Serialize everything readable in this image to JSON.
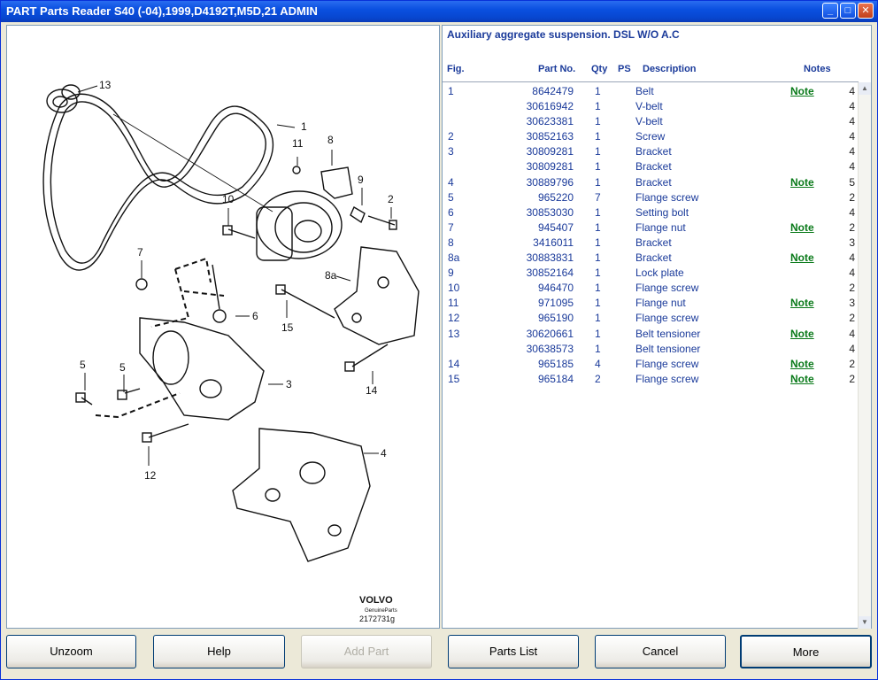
{
  "window": {
    "title": "PART Parts Reader S40 (-04),1999,D4192T,M5D,21 ADMIN",
    "minimize": "_",
    "maximize": "□",
    "close": "✕"
  },
  "drawing": {
    "callouts": [
      "13",
      "1",
      "11",
      "8",
      "9",
      "2",
      "10",
      "7",
      "8a",
      "6",
      "15",
      "5",
      "5",
      "3",
      "14",
      "4",
      "12"
    ],
    "brand": "VOLVO",
    "brand_sub": "GenuineParts",
    "drawing_no": "2172731g"
  },
  "list": {
    "section_title": "Auxiliary aggregate suspension. DSL W/O A.C",
    "headers": {
      "fig": "Fig.",
      "part": "Part No.",
      "qty": "Qty",
      "ps": "PS",
      "desc": "Description",
      "notes": "Notes"
    },
    "rows": [
      {
        "fig": "1",
        "part": "8642479",
        "qty": "1",
        "desc": "Belt",
        "note": "Note",
        "n": "4"
      },
      {
        "fig": "",
        "part": "30616942",
        "qty": "1",
        "desc": "V-belt",
        "note": "",
        "n": "4"
      },
      {
        "fig": "",
        "part": "30623381",
        "qty": "1",
        "desc": "V-belt",
        "note": "",
        "n": "4"
      },
      {
        "fig": "2",
        "part": "30852163",
        "qty": "1",
        "desc": "Screw",
        "note": "",
        "n": "4"
      },
      {
        "fig": "3",
        "part": "30809281",
        "qty": "1",
        "desc": "Bracket",
        "note": "",
        "n": "4"
      },
      {
        "fig": "",
        "part": "30809281",
        "qty": "1",
        "desc": "Bracket",
        "note": "",
        "n": "4"
      },
      {
        "fig": "4",
        "part": "30889796",
        "qty": "1",
        "desc": "Bracket",
        "note": "Note",
        "n": "5"
      },
      {
        "fig": "5",
        "part": "965220",
        "qty": "7",
        "desc": "Flange screw",
        "note": "",
        "n": "2"
      },
      {
        "fig": "6",
        "part": "30853030",
        "qty": "1",
        "desc": "Setting bolt",
        "note": "",
        "n": "4"
      },
      {
        "fig": "7",
        "part": "945407",
        "qty": "1",
        "desc": "Flange nut",
        "note": "Note",
        "n": "2"
      },
      {
        "fig": "8",
        "part": "3416011",
        "qty": "1",
        "desc": "Bracket",
        "note": "",
        "n": "3"
      },
      {
        "fig": "8a",
        "part": "30883831",
        "qty": "1",
        "desc": "Bracket",
        "note": "Note",
        "n": "4"
      },
      {
        "fig": "9",
        "part": "30852164",
        "qty": "1",
        "desc": "Lock plate",
        "note": "",
        "n": "4"
      },
      {
        "fig": "10",
        "part": "946470",
        "qty": "1",
        "desc": "Flange screw",
        "note": "",
        "n": "2"
      },
      {
        "fig": "11",
        "part": "971095",
        "qty": "1",
        "desc": "Flange nut",
        "note": "Note",
        "n": "3"
      },
      {
        "fig": "12",
        "part": "965190",
        "qty": "1",
        "desc": "Flange screw",
        "note": "",
        "n": "2"
      },
      {
        "fig": "13",
        "part": "30620661",
        "qty": "1",
        "desc": "Belt tensioner",
        "note": "Note",
        "n": "4"
      },
      {
        "fig": "",
        "part": "30638573",
        "qty": "1",
        "desc": "Belt tensioner",
        "note": "",
        "n": "4"
      },
      {
        "fig": "14",
        "part": "965185",
        "qty": "4",
        "desc": "Flange screw",
        "note": "Note",
        "n": "2"
      },
      {
        "fig": "15",
        "part": "965184",
        "qty": "2",
        "desc": "Flange screw",
        "note": "Note",
        "n": "2"
      }
    ]
  },
  "buttons": {
    "unzoom": "Unzoom",
    "help": "Help",
    "add_part": "Add Part",
    "parts_list": "Parts List",
    "cancel": "Cancel",
    "more": "More"
  },
  "colors": {
    "titlebar": "#0a50e0",
    "link": "#1a3a9a",
    "note": "#0a7a1a"
  }
}
